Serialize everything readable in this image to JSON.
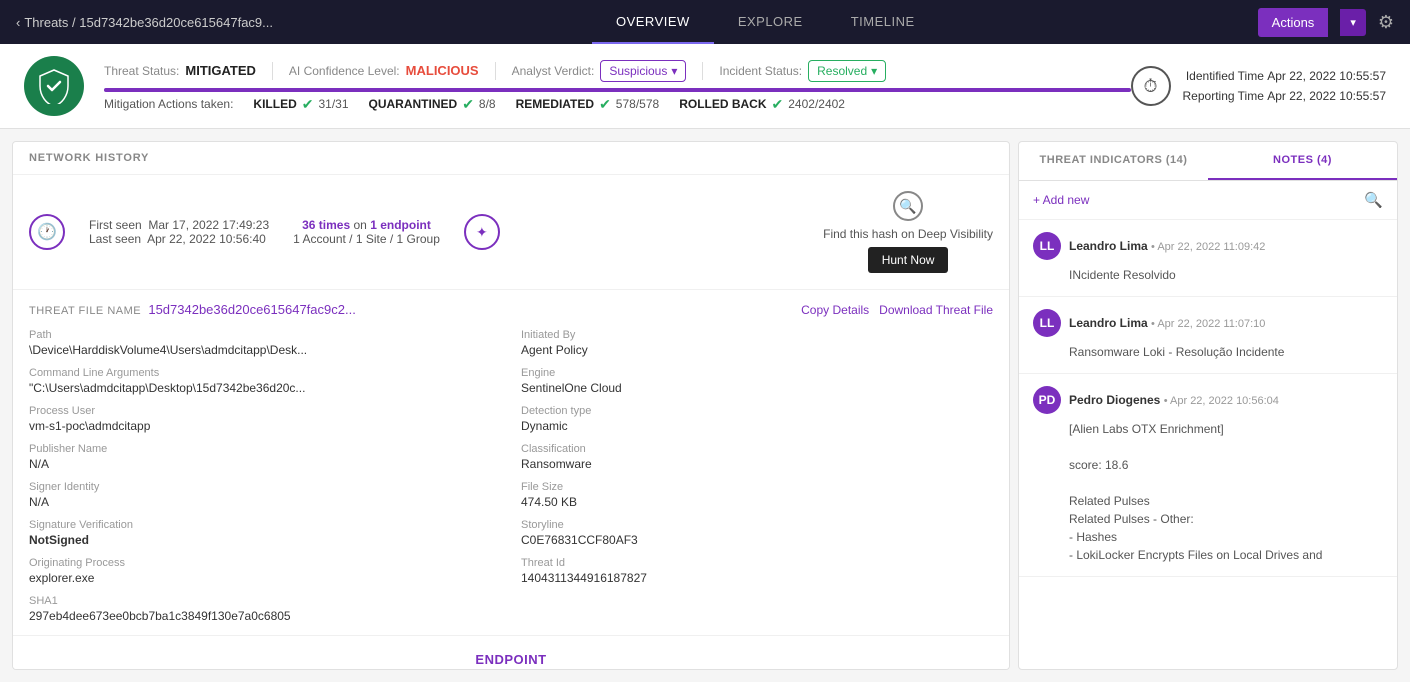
{
  "nav": {
    "breadcrumb": "Threats / 15d7342be36d20ce615647fac9...",
    "tabs": [
      {
        "label": "OVERVIEW",
        "active": true
      },
      {
        "label": "EXPLORE",
        "active": false
      },
      {
        "label": "TIMELINE",
        "active": false
      }
    ],
    "actions_label": "Actions",
    "actions_dropdown_char": "▾",
    "gear_char": "⚙"
  },
  "status": {
    "threat_status_label": "Threat Status:",
    "threat_status_value": "MITIGATED",
    "ai_confidence_label": "AI Confidence Level:",
    "ai_confidence_value": "MALICIOUS",
    "analyst_verdict_label": "Analyst Verdict:",
    "analyst_verdict_value": "Suspicious",
    "incident_status_label": "Incident Status:",
    "incident_status_value": "Resolved",
    "identified_time_label": "Identified Time",
    "identified_time_value": "Apr 22, 2022 10:55:57",
    "reporting_time_label": "Reporting Time",
    "reporting_time_value": "Apr 22, 2022 10:55:57",
    "mitigation_label": "Mitigation Actions taken:",
    "killed_label": "KILLED",
    "killed_value": "31/31",
    "quarantined_label": "QUARANTINED",
    "quarantined_value": "8/8",
    "remediated_label": "REMEDIATED",
    "remediated_value": "578/578",
    "rolled_back_label": "ROLLED BACK",
    "rolled_back_value": "2402/2402"
  },
  "network_history": {
    "section_label": "NETWORK HISTORY",
    "first_seen_label": "First seen",
    "first_seen_value": "Mar 17, 2022 17:49:23",
    "last_seen_label": "Last seen",
    "last_seen_value": "Apr 22, 2022 10:56:40",
    "times_count": "36 times",
    "times_on": "on",
    "endpoint_count": "1 endpoint",
    "account_info": "1 Account / 1 Site / 1 Group",
    "hunt_label": "Find this hash on Deep Visibility",
    "hunt_now_label": "Hunt Now"
  },
  "threat_file": {
    "label": "THREAT FILE NAME",
    "filename": "15d7342be36d20ce615647fac9c2...",
    "copy_details_label": "Copy Details",
    "download_label": "Download Threat File",
    "fields": {
      "path_label": "Path",
      "path_value": "\\Device\\HarddiskVolume4\\Users\\admdcitapp\\Desk...",
      "cmd_label": "Command Line Arguments",
      "cmd_value": "\"C:\\Users\\admdcitapp\\Desktop\\15d7342be36d20c...",
      "process_user_label": "Process User",
      "process_user_value": "vm-s1-poc\\admdcitapp",
      "publisher_label": "Publisher Name",
      "publisher_value": "N/A",
      "signer_label": "Signer Identity",
      "signer_value": "N/A",
      "sig_verify_label": "Signature Verification",
      "sig_verify_value": "NotSigned",
      "orig_process_label": "Originating Process",
      "orig_process_value": "explorer.exe",
      "sha1_label": "SHA1",
      "sha1_value": "297eb4dee673ee0bcb7ba1c3849f130e7a0c6805",
      "initiated_label": "Initiated By",
      "initiated_value": "Agent Policy",
      "engine_label": "Engine",
      "engine_value": "SentinelOne Cloud",
      "detection_label": "Detection type",
      "detection_value": "Dynamic",
      "classification_label": "Classification",
      "classification_value": "Ransomware",
      "file_size_label": "File Size",
      "file_size_value": "474.50 KB",
      "storyline_label": "Storyline",
      "storyline_value": "C0E76831CCF80AF3",
      "threat_id_label": "Threat Id",
      "threat_id_value": "1404311344916187827"
    }
  },
  "right_panel": {
    "tabs": [
      {
        "label": "THREAT INDICATORS (14)",
        "active": false
      },
      {
        "label": "NOTES (4)",
        "active": true
      }
    ],
    "add_new_label": "+ Add new",
    "notes": [
      {
        "author": "Leandro Lima",
        "time": "Apr 22, 2022 11:09:42",
        "body": "INcidente Resolvido",
        "initials": "LL"
      },
      {
        "author": "Leandro Lima",
        "time": "Apr 22, 2022 11:07:10",
        "body": "Ransomware Loki - Resolução Incidente",
        "initials": "LL"
      },
      {
        "author": "Pedro Diogenes",
        "time": "Apr 22, 2022 10:56:04",
        "body": "[Alien Labs OTX Enrichment]\n\nscore: 18.6\n\nRelated Pulses\nRelated Pulses - Other:\n  - Hashes\n  - LokiLocker Encrypts Files on Local Drives and",
        "initials": "PD"
      }
    ]
  },
  "endpoint_section": {
    "label": "ENDPOINT"
  }
}
